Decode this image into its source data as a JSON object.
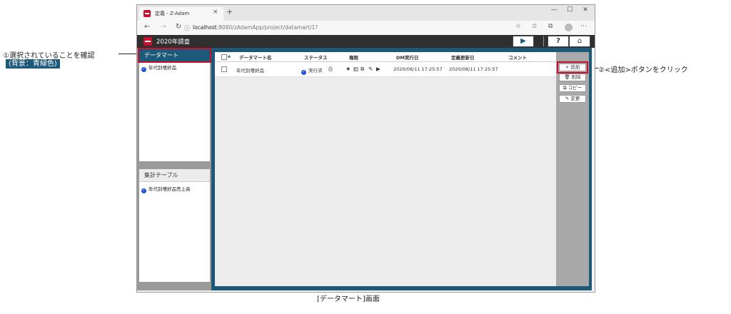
{
  "browser": {
    "tab_title": "定義 - Z-Adam",
    "tab_close": "×",
    "new_tab": "+",
    "window_controls": [
      "—",
      "☐",
      "✕"
    ],
    "nav_icons": [
      "←",
      "→",
      "↻"
    ],
    "info_icon": "ⓘ",
    "url_host": "localhost",
    "url_rest": ":8080/zAdamApp/project/datamart/1?",
    "toolbar_icons": [
      "☆",
      "✩",
      "⧉",
      "⋯"
    ]
  },
  "app": {
    "project_title": "2020年調査",
    "run_icon": "▶",
    "help_icon": "?",
    "home_icon": "⌂"
  },
  "left": {
    "datamart_header": "データマート",
    "datamart_items": [
      "年代別嗜好品"
    ],
    "aggregate_header": "集計テーブル",
    "aggregate_items": [
      "年代別嗜好品売上高"
    ]
  },
  "table": {
    "sort_icon": "▲",
    "columns": [
      "データマート名",
      "ステータス",
      "権限",
      "DM実行日",
      "定義更新日",
      "コメント"
    ],
    "rows": [
      {
        "name": "年代別嗜好品",
        "status": "実行済",
        "dm_date": "2020/08/11 17:25:57",
        "def_date": "2020/08/11 17:25:57",
        "comment": ""
      }
    ],
    "print_icon": "⎙",
    "permission_icons": [
      "👁",
      "🗑",
      "⧉",
      "✎",
      "▶"
    ]
  },
  "actions": {
    "add": "+ 追加",
    "delete": "🗑 削除",
    "copy": "⧉ コピー",
    "edit": "✎ 変更"
  },
  "annotations": {
    "note1": "①選択されていることを確認",
    "note1_sub": "(背景：青緑色)",
    "note2": "②<追加>ボタンをクリック",
    "caption": "[データマート]画面"
  },
  "colors": {
    "accent": "#1d5a7a",
    "highlight": "#c8102e",
    "check": "#1f4fd6"
  }
}
